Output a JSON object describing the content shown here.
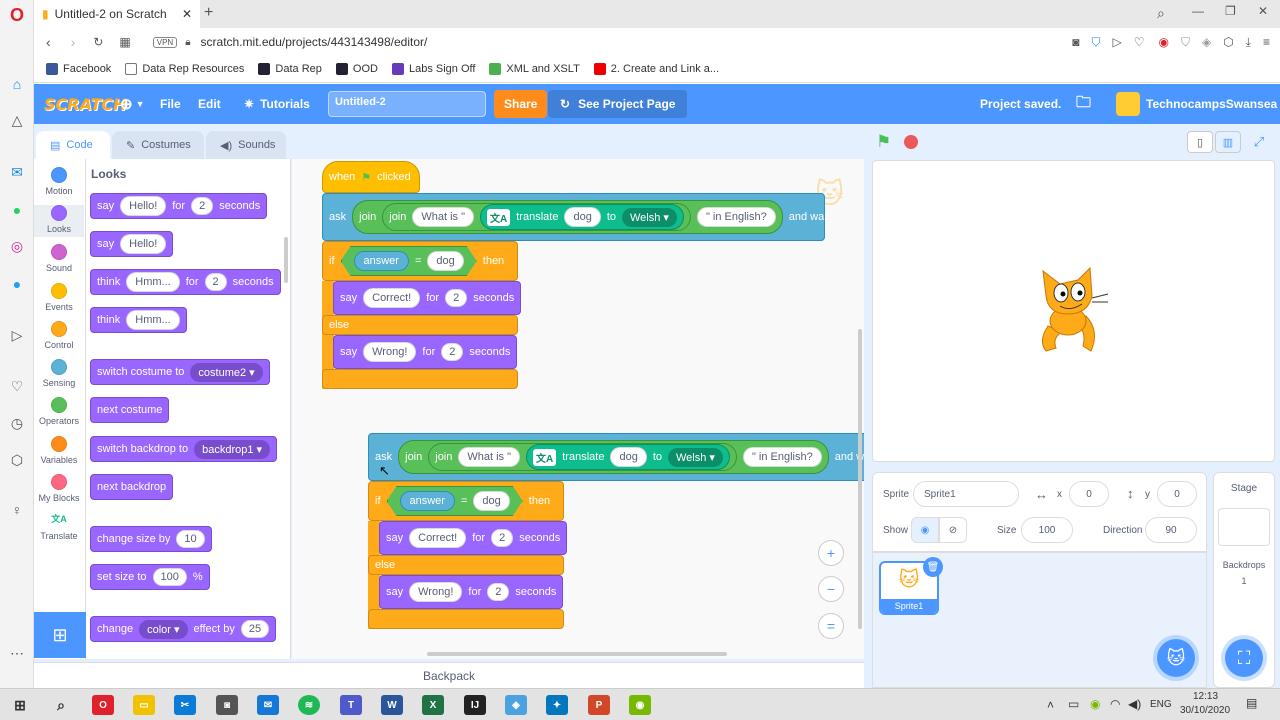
{
  "browser": {
    "tab_title": "Untitled-2 on Scratch",
    "url": "scratch.mit.edu/projects/443143498/editor/",
    "vpn": "VPN",
    "bookmarks": [
      "Facebook",
      "Data Rep Resources",
      "Data Rep",
      "OOD",
      "Labs Sign Off",
      "XML and XSLT",
      "2. Create and Link a..."
    ]
  },
  "menu": {
    "logo": "SCRATCH",
    "file": "File",
    "edit": "Edit",
    "tutorials": "Tutorials",
    "project_title": "Untitled-2",
    "share": "Share",
    "see_project": "See Project Page",
    "status": "Project saved.",
    "username": "TechnocampsSwansea"
  },
  "editor_tabs": {
    "code": "Code",
    "costumes": "Costumes",
    "sounds": "Sounds"
  },
  "categories": [
    {
      "label": "Motion",
      "color": "#4c97ff"
    },
    {
      "label": "Looks",
      "color": "#9966ff"
    },
    {
      "label": "Sound",
      "color": "#cf63cf"
    },
    {
      "label": "Events",
      "color": "#ffbf00"
    },
    {
      "label": "Control",
      "color": "#ffab19"
    },
    {
      "label": "Sensing",
      "color": "#5cb1d6"
    },
    {
      "label": "Operators",
      "color": "#59c059"
    },
    {
      "label": "Variables",
      "color": "#ff8c1a"
    },
    {
      "label": "My Blocks",
      "color": "#ff6680"
    },
    {
      "label": "Translate",
      "color": "#0fbd8c"
    }
  ],
  "palette": {
    "heading": "Looks",
    "say": "say",
    "hello": "Hello!",
    "for": "for",
    "two": "2",
    "seconds": "seconds",
    "think": "think",
    "hmm": "Hmm...",
    "switch_costume": "switch costume to",
    "costume2": "costume2",
    "next_costume": "next costume",
    "switch_backdrop": "switch backdrop to",
    "backdrop1": "backdrop1",
    "next_backdrop": "next backdrop",
    "change_size": "change size by",
    "ten": "10",
    "set_size": "set size to",
    "hundred": "100",
    "percent": "%",
    "change": "change",
    "color": "color",
    "effect_by": "effect by",
    "twentyfive": "25"
  },
  "script": {
    "when": "when",
    "clicked": "clicked",
    "ask": "ask",
    "join": "join",
    "what_is": "What is \"",
    "translate": "translate",
    "dog": "dog",
    "to": "to",
    "welsh": "Welsh",
    "in_english": "\" in English?",
    "and_wait": "and wait",
    "if": "if",
    "answer": "answer",
    "eq": "=",
    "then": "then",
    "say": "say",
    "correct": "Correct!",
    "for": "for",
    "two": "2",
    "seconds": "seconds",
    "else": "else",
    "wrong": "Wrong!"
  },
  "backpack": "Backpack",
  "sprite_info": {
    "sprite_label": "Sprite",
    "sprite_name": "Sprite1",
    "x_label": "x",
    "x": "0",
    "y_label": "y",
    "y": "0",
    "show_label": "Show",
    "size_label": "Size",
    "size": "100",
    "direction_label": "Direction",
    "direction": "90"
  },
  "sprite_list": {
    "thumb_label": "Sprite1"
  },
  "stage_panel": {
    "title": "Stage",
    "backdrops_label": "Backdrops",
    "backdrops_count": "1"
  },
  "taskbar": {
    "lang": "ENG",
    "time": "12:13",
    "date": "30/10/2020"
  }
}
